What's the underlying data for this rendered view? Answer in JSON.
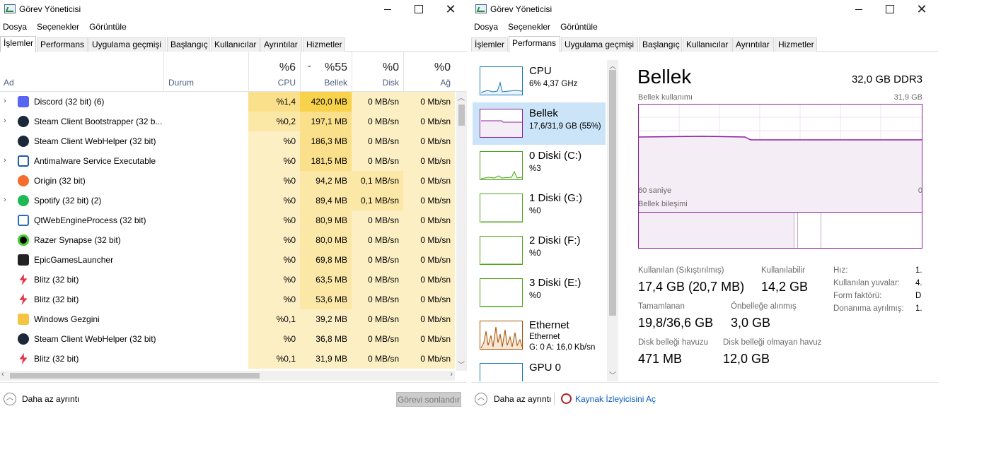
{
  "left_window": {
    "title": "Görev Yöneticisi",
    "menu": [
      "Dosya",
      "Seçenekler",
      "Görüntüle"
    ],
    "tabs": [
      "İşlemler",
      "Performans",
      "Uygulama geçmişi",
      "Başlangıç",
      "Kullanıcılar",
      "Ayrıntılar",
      "Hizmetler"
    ],
    "active_tab": "İşlemler",
    "columns": {
      "name": "Ad",
      "status": "Durum",
      "cpu_pct": "%6",
      "cpu": "CPU",
      "mem_pct": "%55",
      "mem": "Bellek",
      "disk_pct": "%0",
      "disk": "Disk",
      "net_pct": "%0",
      "net": "Ağ"
    },
    "processes": [
      {
        "name": "Discord (32 bit) (6)",
        "expand": true,
        "icon": "discord-icon",
        "cpu": "%1,4",
        "mem": "420,0 MB",
        "disk": "0 MB/sn",
        "net": "0 Mb/sn"
      },
      {
        "name": "Steam Client Bootstrapper (32 b...",
        "expand": true,
        "icon": "steam-icon",
        "cpu": "%0,2",
        "mem": "197,1 MB",
        "disk": "0 MB/sn",
        "net": "0 Mb/sn"
      },
      {
        "name": "Steam Client WebHelper (32 bit)",
        "expand": false,
        "icon": "steam-icon",
        "cpu": "%0",
        "mem": "186,3 MB",
        "disk": "0 MB/sn",
        "net": "0 Mb/sn"
      },
      {
        "name": "Antimalware Service Executable",
        "expand": true,
        "icon": "antimalware-icon",
        "cpu": "%0",
        "mem": "181,5 MB",
        "disk": "0 MB/sn",
        "net": "0 Mb/sn"
      },
      {
        "name": "Origin (32 bit)",
        "expand": false,
        "icon": "origin-icon",
        "cpu": "%0",
        "mem": "94,2 MB",
        "disk": "0,1 MB/sn",
        "net": "0 Mb/sn"
      },
      {
        "name": "Spotify (32 bit) (2)",
        "expand": true,
        "icon": "spotify-icon",
        "cpu": "%0",
        "mem": "89,4 MB",
        "disk": "0,1 MB/sn",
        "net": "0 Mb/sn"
      },
      {
        "name": "QtWebEngineProcess (32 bit)",
        "expand": false,
        "icon": "window-icon",
        "cpu": "%0",
        "mem": "80,9 MB",
        "disk": "0 MB/sn",
        "net": "0 Mb/sn"
      },
      {
        "name": "Razer Synapse (32 bit)",
        "expand": false,
        "icon": "razer-icon",
        "cpu": "%0",
        "mem": "80,0 MB",
        "disk": "0 MB/sn",
        "net": "0 Mb/sn"
      },
      {
        "name": "EpicGamesLauncher",
        "expand": false,
        "icon": "epic-icon",
        "cpu": "%0",
        "mem": "69,8 MB",
        "disk": "0 MB/sn",
        "net": "0 Mb/sn"
      },
      {
        "name": "Blitz (32 bit)",
        "expand": false,
        "icon": "blitz-icon",
        "cpu": "%0",
        "mem": "63,5 MB",
        "disk": "0 MB/sn",
        "net": "0 Mb/sn"
      },
      {
        "name": "Blitz (32 bit)",
        "expand": false,
        "icon": "blitz-icon",
        "cpu": "%0",
        "mem": "53,6 MB",
        "disk": "0 MB/sn",
        "net": "0 Mb/sn"
      },
      {
        "name": "Windows Gezgini",
        "expand": false,
        "icon": "folder-icon",
        "cpu": "%0,1",
        "mem": "39,2 MB",
        "disk": "0 MB/sn",
        "net": "0 Mb/sn"
      },
      {
        "name": "Steam Client WebHelper (32 bit)",
        "expand": false,
        "icon": "steam-icon",
        "cpu": "%0",
        "mem": "36,8 MB",
        "disk": "0 MB/sn",
        "net": "0 Mb/sn"
      },
      {
        "name": "Blitz (32 bit)",
        "expand": false,
        "icon": "blitz-icon",
        "cpu": "%0,1",
        "mem": "31,9 MB",
        "disk": "0 MB/sn",
        "net": "0 Mb/sn"
      }
    ],
    "footer": {
      "less_details": "Daha az ayrıntı",
      "end_task": "Görevi sonlandır"
    }
  },
  "right_window": {
    "title": "Görev Yöneticisi",
    "menu": [
      "Dosya",
      "Seçenekler",
      "Görüntüle"
    ],
    "tabs": [
      "İşlemler",
      "Performans",
      "Uygulama geçmişi",
      "Başlangıç",
      "Kullanıcılar",
      "Ayrıntılar",
      "Hizmetler"
    ],
    "active_tab": "Performans",
    "sidebar": [
      {
        "title": "CPU",
        "sub": "6%  4,37 GHz",
        "sub2": "",
        "color": "#1779ba",
        "selected": false
      },
      {
        "title": "Bellek",
        "sub": "17,6/31,9 GB (55%)",
        "sub2": "",
        "color": "#8b1fa0",
        "selected": true
      },
      {
        "title": "0 Diski (C:)",
        "sub": "%3",
        "sub2": "",
        "color": "#4da41a",
        "selected": false
      },
      {
        "title": "1 Diski (G:)",
        "sub": "%0",
        "sub2": "",
        "color": "#4da41a",
        "selected": false
      },
      {
        "title": "2 Diski (F:)",
        "sub": "%0",
        "sub2": "",
        "color": "#4da41a",
        "selected": false
      },
      {
        "title": "3 Diski (E:)",
        "sub": "%0",
        "sub2": "",
        "color": "#4da41a",
        "selected": false
      },
      {
        "title": "Ethernet",
        "sub": "Ethernet",
        "sub2": "G: 0  A: 16,0 Kb/sn",
        "color": "#a74f01",
        "selected": false
      },
      {
        "title": "GPU 0",
        "sub": "",
        "sub2": "",
        "color": "#1779ba",
        "selected": false
      }
    ],
    "detail": {
      "title": "Bellek",
      "total": "32,0 GB DDR3",
      "usage_label": "Bellek kullanımı",
      "usage_max": "31,9 GB",
      "time_left": "60 saniye",
      "time_right": "0",
      "composition_label": "Bellek bileşimi",
      "used_fraction": 0.55,
      "stats": {
        "in_use_label": "Kullanılan (Sıkıştırılmış)",
        "in_use": "17,4 GB (20,7 MB)",
        "available_label": "Kullanılabilir",
        "available": "14,2 GB",
        "committed_label": "Tamamlanan",
        "committed": "19,8/36,6 GB",
        "cached_label": "Önbelleğe alınmış",
        "cached": "3,0 GB",
        "paged_label": "Disk belleği havuzu",
        "paged": "471 MB",
        "nonpaged_label": "Disk belleği olmayan havuz",
        "nonpaged": "12,0 GB",
        "speed_label": "Hız:",
        "speed": "1.",
        "slots_label": "Kullanılan yuvalar:",
        "slots": "4.",
        "form_label": "Form faktörü:",
        "form": "D",
        "reserved_label": "Donanıma ayrılmış:",
        "reserved": "1."
      }
    },
    "footer": {
      "less_details": "Daha az ayrıntı",
      "resmon": "Kaynak İzleyicisini Aç"
    }
  }
}
